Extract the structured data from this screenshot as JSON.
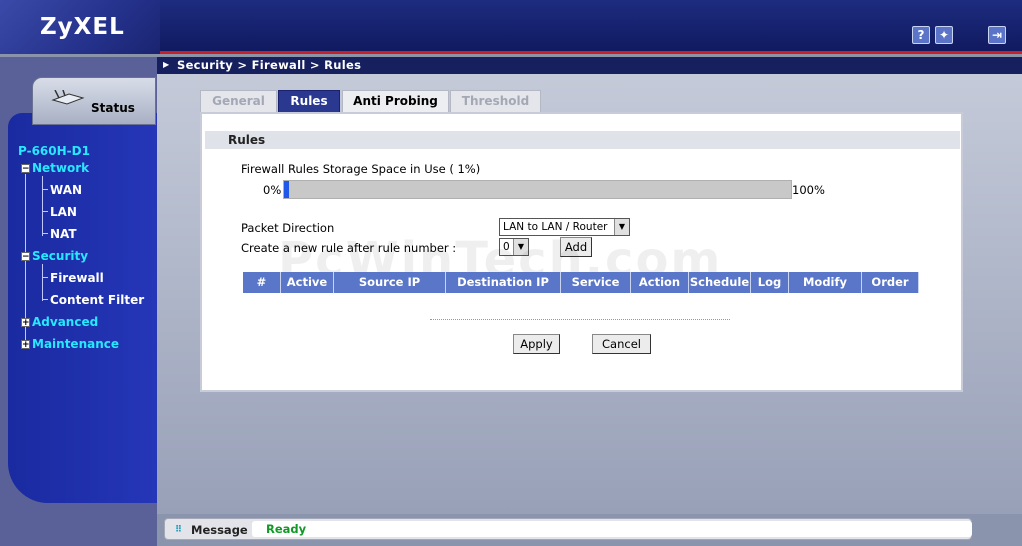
{
  "header": {
    "brand": "ZyXEL",
    "help_icon": "help-icon",
    "wizard_icon": "wizard-icon",
    "logout_icon": "logout-icon"
  },
  "breadcrumb": "Security > Firewall > Rules",
  "sidebar": {
    "status_tab": "Status",
    "device": "P-660H-D1",
    "network": {
      "label": "Network",
      "items": [
        "WAN",
        "LAN",
        "NAT"
      ]
    },
    "security": {
      "label": "Security",
      "items": [
        "Firewall",
        "Content Filter"
      ]
    },
    "advanced": "Advanced",
    "maintenance": "Maintenance"
  },
  "tabs": [
    "General",
    "Rules",
    "Anti Probing",
    "Threshold"
  ],
  "section": {
    "title": "Rules",
    "storage_label": "Firewall Rules Storage Space in Use  ( 1%)",
    "storage_percent": 1,
    "bar_min": "0%",
    "bar_max": "100%",
    "packet_direction_label": "Packet Direction",
    "packet_direction_value": "LAN to LAN / Router",
    "new_rule_label": "Create a new rule after rule number :",
    "new_rule_value": "0",
    "add_label": "Add"
  },
  "table": {
    "columns": [
      "#",
      "Active",
      "Source IP",
      "Destination IP",
      "Service",
      "Action",
      "Schedule",
      "Log",
      "Modify",
      "Order"
    ]
  },
  "buttons": {
    "apply": "Apply",
    "cancel": "Cancel"
  },
  "watermark": "PcWinTech.com",
  "message": {
    "label": "Message",
    "value": "Ready"
  },
  "colors": {
    "header": "#16205e",
    "accent_red": "#c8202a",
    "nav_text": "#27e8ff",
    "table_header": "#5a76c8",
    "status_ready": "#119928"
  }
}
